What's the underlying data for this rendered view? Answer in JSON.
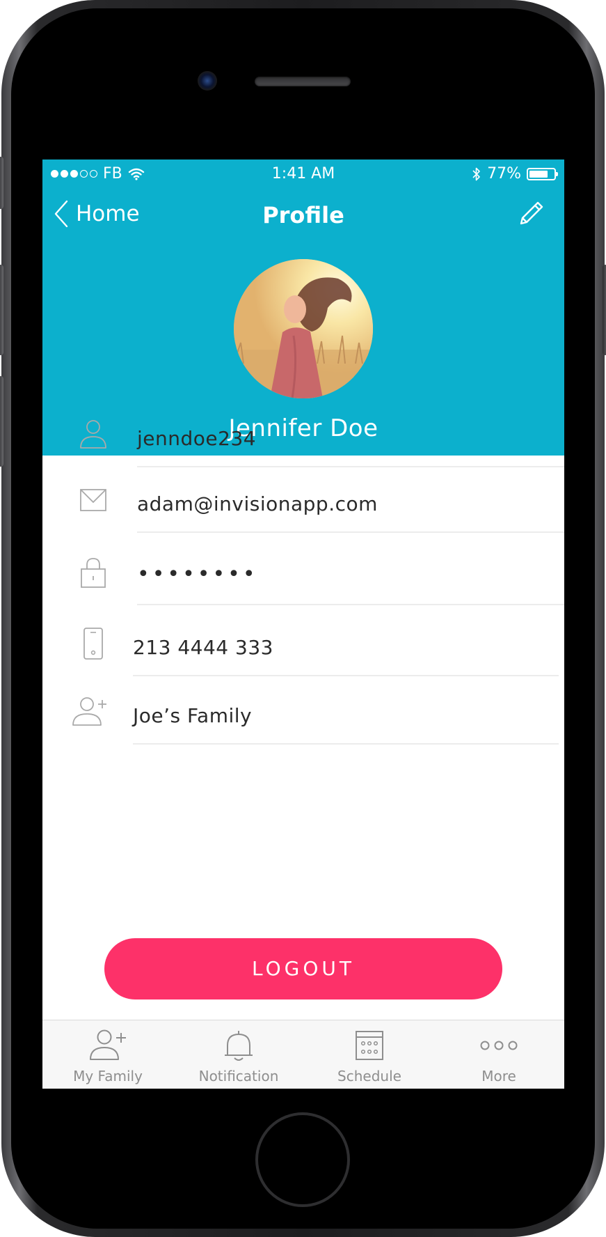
{
  "status_bar": {
    "carrier": "FB",
    "time": "1:41 AM",
    "battery": "77%",
    "battery_level": 0.77,
    "signal_filled": 3,
    "signal_total": 5
  },
  "nav": {
    "back_label": "Home",
    "title": "Profile"
  },
  "profile": {
    "name": "Jennifer Doe"
  },
  "fields": [
    {
      "icon": "user-icon",
      "value": "jenndoe234"
    },
    {
      "icon": "mail-icon",
      "value": "adam@invisionapp.com"
    },
    {
      "icon": "lock-icon",
      "value": "••••••••"
    },
    {
      "icon": "phone-icon",
      "value": "213 4444 333"
    },
    {
      "icon": "add-user-icon",
      "value": "Joe’s Family"
    }
  ],
  "logout_label": "LOGOUT",
  "tabs": [
    {
      "label": "My Family",
      "icon": "add-user-icon"
    },
    {
      "label": "Notification",
      "icon": "bell-icon"
    },
    {
      "label": "Schedule",
      "icon": "calendar-icon"
    },
    {
      "label": "More",
      "icon": "more-icon"
    }
  ],
  "colors": {
    "header": "#0cb0cd",
    "logout": "#fd3169",
    "tab_icon": "#8e8e8e"
  }
}
